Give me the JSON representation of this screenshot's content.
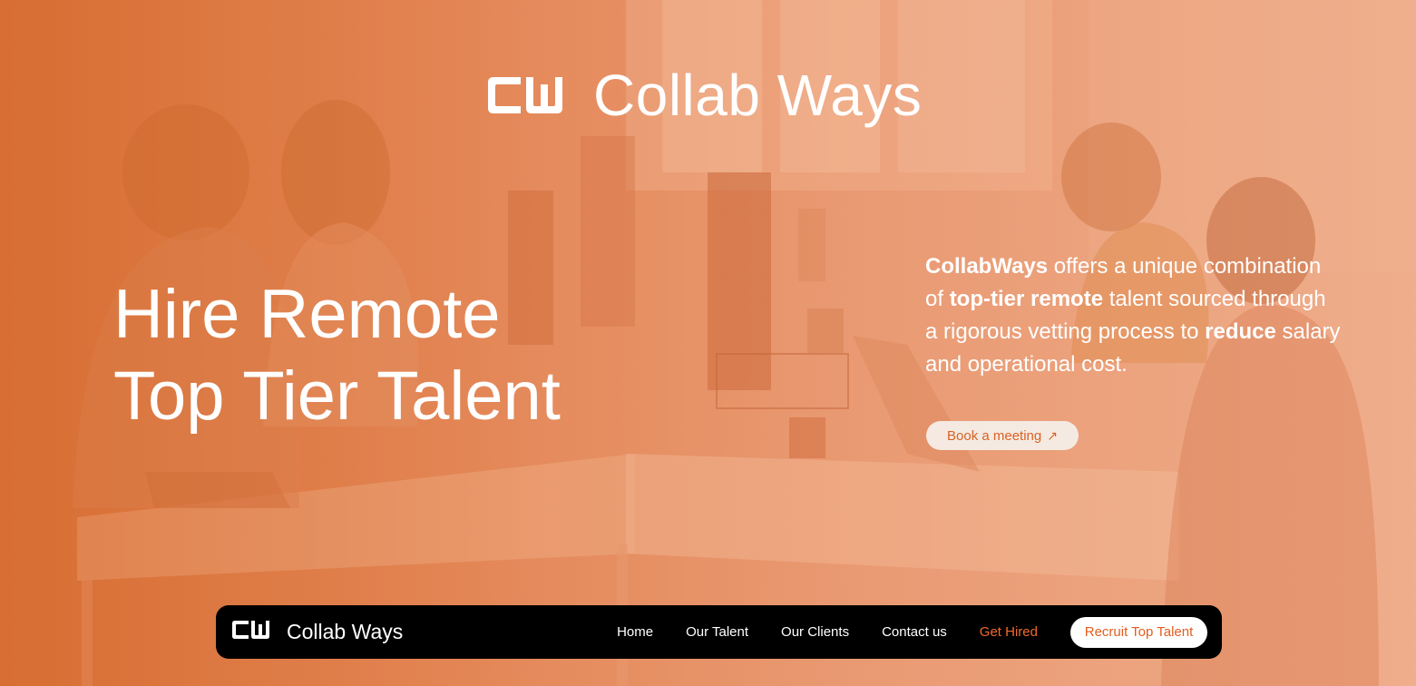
{
  "brand": {
    "logo_icon": "cw-logo-icon",
    "name": "Collab Ways"
  },
  "hero": {
    "headline_line1": "Hire Remote",
    "headline_line2": "Top Tier Talent",
    "copy": {
      "p1_bold": "CollabWays",
      "p2": " offers a unique combination of ",
      "p3_bold": "top-tier remote",
      "p4": " talent sourced through a rigorous vetting process to ",
      "p5_bold": "reduce",
      "p6": " salary and operational cost."
    },
    "cta": {
      "label": "Book a meeting",
      "icon": "arrow-up-right-icon",
      "arrow_glyph": "↗"
    }
  },
  "nav": {
    "brand_name": "Collab Ways",
    "links": [
      "Home",
      "Our Talent",
      "Our Clients",
      "Contact us",
      "Get Hired"
    ],
    "cta_label": "Recruit Top Talent"
  },
  "colors": {
    "accent": "#e35d1f",
    "nav_bg": "#000000",
    "hero_overlay": "#e4804c"
  }
}
